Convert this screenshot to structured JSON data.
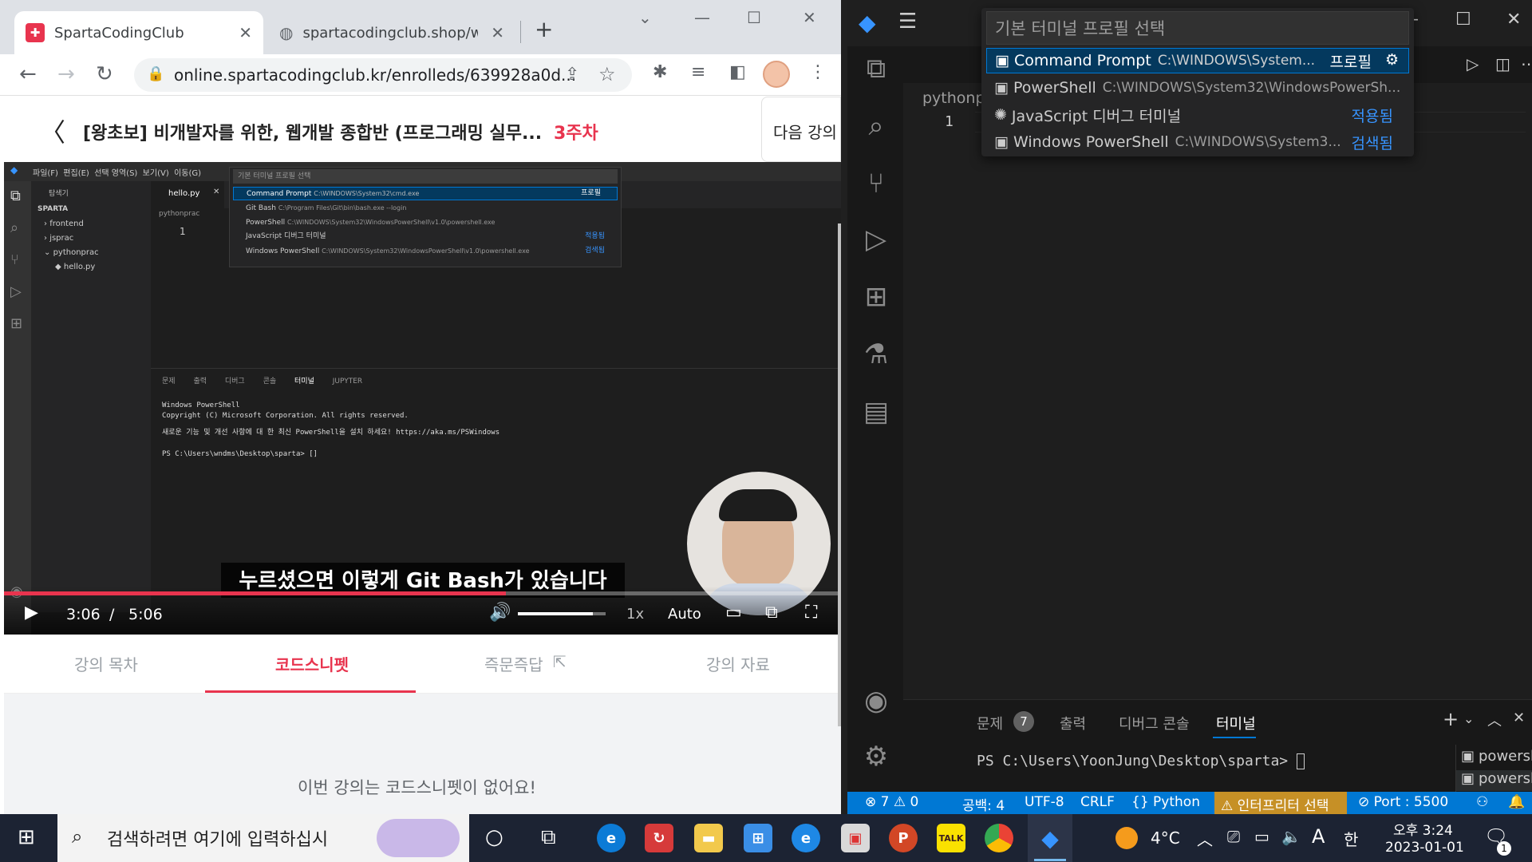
{
  "chrome": {
    "tabs": [
      {
        "title": "SpartaCodingClub",
        "active": true
      },
      {
        "title": "spartacodingclub.shop/wel",
        "active": false
      }
    ],
    "new_tab": "+",
    "address": "online.spartacodingclub.kr/enrolleds/639928a0d...",
    "course_title": "[왕초보] 비개발자를 위한, 웹개발 종합반 (프로그래밍 실무...",
    "week": "3주차",
    "next_lecture": "다음 강의"
  },
  "video": {
    "editor_overlay": {
      "quickpick_title": "기본 터미널 프로필 선택",
      "items": [
        {
          "name": "Command Prompt",
          "desc": "C:\\WINDOWS\\System32\\cmd.exe",
          "tag": "프로필"
        },
        {
          "name": "Git Bash",
          "desc": "C:\\Program Files\\Git\\bin\\bash.exe --login",
          "tag": ""
        },
        {
          "name": "PowerShell",
          "desc": "C:\\WINDOWS\\System32\\WindowsPowerShell\\v1.0\\powershell.exe",
          "tag": ""
        },
        {
          "name": "JavaScript 디버그 터미널",
          "desc": "",
          "tag": "적용됨"
        },
        {
          "name": "Windows PowerShell",
          "desc": "C:\\WINDOWS\\System32\\WindowsPowerShell\\v1.0\\powershell.exe",
          "tag": "검색됨"
        }
      ],
      "explorer_title": "탐색기",
      "workspace": "SPARTA",
      "folders": [
        "frontend",
        "jsprac",
        "pythonprac",
        "hello.py"
      ],
      "editor_tab": "hello.py",
      "breadcrumb": "pythonprac",
      "line": "1",
      "panel_tabs": [
        "문제",
        "출력",
        "디버그 콘솔",
        "터미널",
        "JUPYTER"
      ],
      "terminal_lines": [
        "Windows PowerShell",
        "Copyright (C) Microsoft Corporation. All rights reserved.",
        "새로운 기능 및 개선 사항에 대 한 최신 PowerShell을 설치 하세요! https://aka.ms/PSWindows",
        "PS C:\\Users\\wndms\\Desktop\\sparta> []"
      ]
    },
    "subtitle": "누르셨으면 이렇게 Git Bash가 있습니다",
    "current_time": "3:06",
    "separator": "/",
    "duration": "5:06",
    "speed": "1x",
    "quality": "Auto",
    "progress_fraction": 0.6,
    "volume_fraction": 0.85
  },
  "course_tabs": [
    {
      "label": "강의 목차",
      "active": false
    },
    {
      "label": "코드스니펫",
      "active": true
    },
    {
      "label": "즉문즉답",
      "active": false
    },
    {
      "label": "강의 자료",
      "active": false
    }
  ],
  "snippet_empty": "이번 강의는 코드스니펫이 없어요!",
  "vscode": {
    "quickpick": {
      "placeholder": "기본 터미널 프로필 선택",
      "items": [
        {
          "name": "Command Prompt",
          "desc": "C:\\WINDOWS\\System...",
          "tag": "프로필",
          "selected": true
        },
        {
          "name": "PowerShell",
          "desc": "C:\\WINDOWS\\System32\\WindowsPowerSh...",
          "tag": "",
          "selected": false
        },
        {
          "name": "JavaScript 디버그 터미널",
          "desc": "",
          "tag": "적용됨",
          "selected": false
        },
        {
          "name": "Windows PowerShell",
          "desc": "C:\\WINDOWS\\System3...",
          "tag": "검색됨",
          "selected": false
        }
      ]
    },
    "breadcrumb": "pythonp",
    "line_number": "1",
    "panel": {
      "tabs": [
        "문제",
        "출력",
        "디버그 콘솔",
        "터미널"
      ],
      "problems_count": "7",
      "active_tab": "터미널",
      "prompt": "PS C:\\Users\\YoonJung\\Desktop\\sparta> ",
      "terminals": [
        "powershell",
        "powershell"
      ]
    },
    "status": {
      "errors": "7",
      "warnings": "0",
      "spaces": "공백: 4",
      "encoding": "UTF-8",
      "eol": "CRLF",
      "language": "Python",
      "interpreter": "인터프리터 선택",
      "port": "Port : 5500"
    }
  },
  "taskbar": {
    "search_placeholder": "검색하려면 여기에 입력하십시",
    "weather": "4°C",
    "ime": "A",
    "lang": "한",
    "time": "오후 3:24",
    "date": "2023-01-01",
    "notifications": "1"
  },
  "colors": {
    "sparta_red": "#e8344e",
    "vscode_blue": "#0078d4",
    "quickpick_selected": "#04395e",
    "interpreter_warn": "#c69026"
  }
}
